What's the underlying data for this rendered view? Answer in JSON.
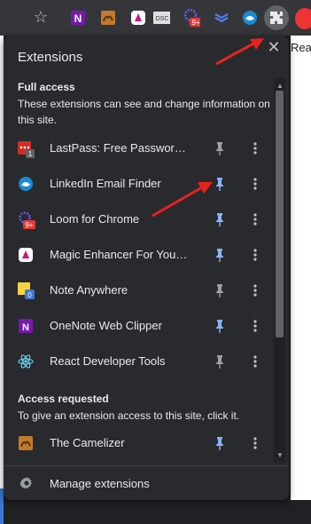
{
  "toolbar": {
    "icons": [
      "star-icon",
      "onenote-icon",
      "camelizer-icon",
      "magic-enhancer-icon",
      "dsc-icon",
      "loom-icon",
      "stack-icon",
      "linkedin-finder-icon",
      "extensions-puzzle-icon",
      "avatar"
    ],
    "loom_badge": "9+",
    "dsc_text": "DSC",
    "tab_text": "Readi"
  },
  "popup": {
    "title": "Extensions",
    "full_access": {
      "heading": "Full access",
      "description": "These extensions can see and change information on this site.",
      "items": [
        {
          "label": "LastPass: Free Password Ma...",
          "icon": "lastpass-icon",
          "badge": "1",
          "pinned": false
        },
        {
          "label": "LinkedIn Email Finder",
          "icon": "linkedin-finder-icon",
          "pinned": true
        },
        {
          "label": "Loom for Chrome",
          "icon": "loom-icon",
          "badge": "9+",
          "pinned": true
        },
        {
          "label": "Magic Enhancer For YouTub...",
          "icon": "magic-enhancer-icon",
          "pinned": true
        },
        {
          "label": "Note Anywhere",
          "icon": "note-anywhere-icon",
          "badge": "0",
          "pinned": false
        },
        {
          "label": "OneNote Web Clipper",
          "icon": "onenote-icon",
          "pinned": true
        },
        {
          "label": "React Developer Tools",
          "icon": "react-icon",
          "pinned": false
        }
      ]
    },
    "access_requested": {
      "heading": "Access requested",
      "description": "To give an extension access to this site, click it.",
      "items": [
        {
          "label": "The Camelizer",
          "icon": "camelizer-icon",
          "pinned": true
        }
      ]
    },
    "manage_label": "Manage extensions"
  },
  "colors": {
    "popup_bg": "#292a2d",
    "pinned": "#8ab4f8",
    "unpinned": "#9aa0a6",
    "annotation_arrow": "#e8231e"
  }
}
